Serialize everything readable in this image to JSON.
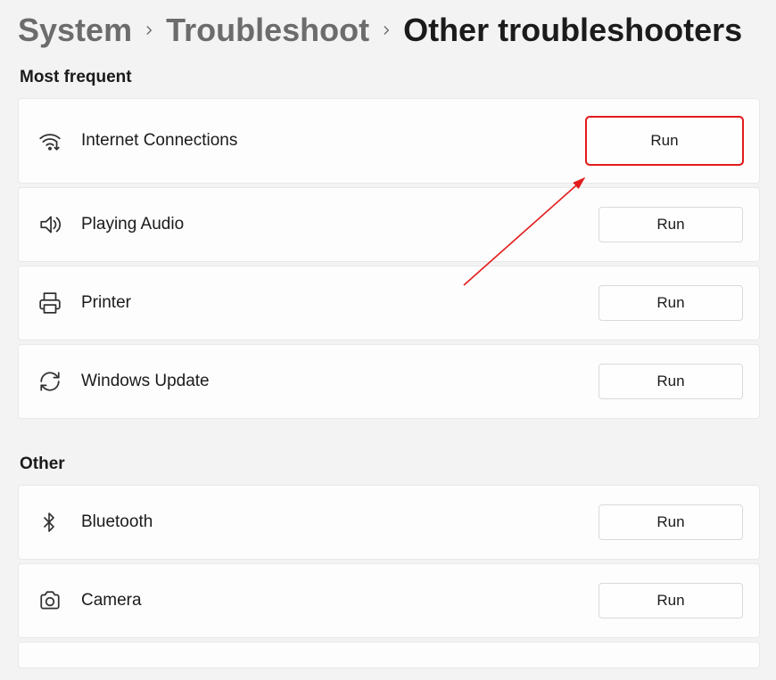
{
  "breadcrumb": {
    "level1": "System",
    "level2": "Troubleshoot",
    "current": "Other troubleshooters"
  },
  "sections": {
    "most_frequent": {
      "title": "Most frequent",
      "items": [
        {
          "label": "Internet Connections",
          "button": "Run",
          "icon": "wifi-icon",
          "highlight": true
        },
        {
          "label": "Playing Audio",
          "button": "Run",
          "icon": "speaker-icon"
        },
        {
          "label": "Printer",
          "button": "Run",
          "icon": "printer-icon"
        },
        {
          "label": "Windows Update",
          "button": "Run",
          "icon": "refresh-icon"
        }
      ]
    },
    "other": {
      "title": "Other",
      "items": [
        {
          "label": "Bluetooth",
          "button": "Run",
          "icon": "bluetooth-icon"
        },
        {
          "label": "Camera",
          "button": "Run",
          "icon": "camera-icon"
        }
      ]
    }
  },
  "annotation": {
    "color": "#e31b1b"
  }
}
